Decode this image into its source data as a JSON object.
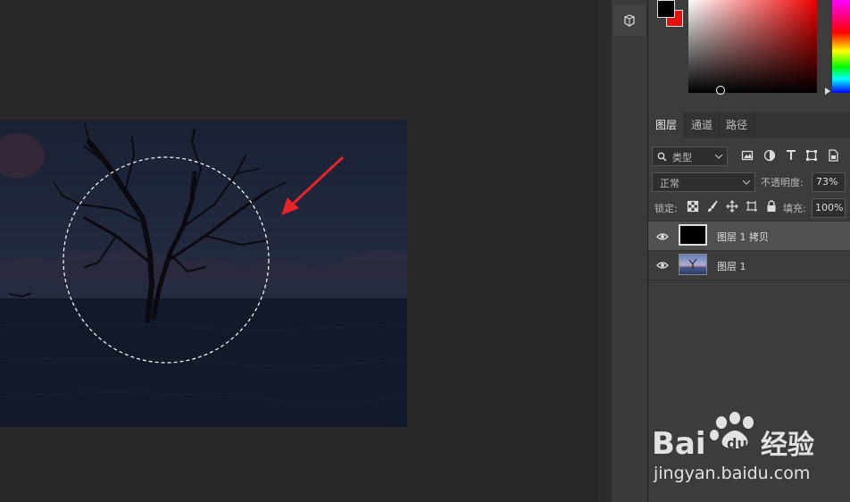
{
  "colors": {
    "canvas_bg": "#282828",
    "panel_bg": "#3c3c3c",
    "arrow": "#e8232a",
    "foreground_swatch": "#000000",
    "background_swatch": "#e61010"
  },
  "layers_panel": {
    "tabs": [
      {
        "label": "图层",
        "active": true
      },
      {
        "label": "通道",
        "active": false
      },
      {
        "label": "路径",
        "active": false
      }
    ],
    "filter": {
      "label": "类型",
      "icon": "search-icon"
    },
    "filter_icons": [
      "image-filter-icon",
      "adjustment-filter-icon",
      "type-filter-icon",
      "shape-filter-icon",
      "smart-object-filter-icon"
    ],
    "blend_mode": "正常",
    "opacity_label": "不透明度:",
    "opacity_value": "73%",
    "lock_label": "锁定:",
    "lock_icons": [
      "lock-transparent-icon",
      "lock-brush-icon",
      "lock-position-icon",
      "lock-artboard-icon",
      "lock-all-icon"
    ],
    "fill_label": "填充:",
    "fill_value": "100%",
    "layers": [
      {
        "name": "图层 1 拷贝",
        "visible": true,
        "selected": true,
        "thumb": "black"
      },
      {
        "name": "图层 1",
        "visible": true,
        "selected": false,
        "thumb": "photo"
      }
    ]
  },
  "watermark": {
    "brand": "Bai经验",
    "url": "jingyan.baidu.com"
  }
}
